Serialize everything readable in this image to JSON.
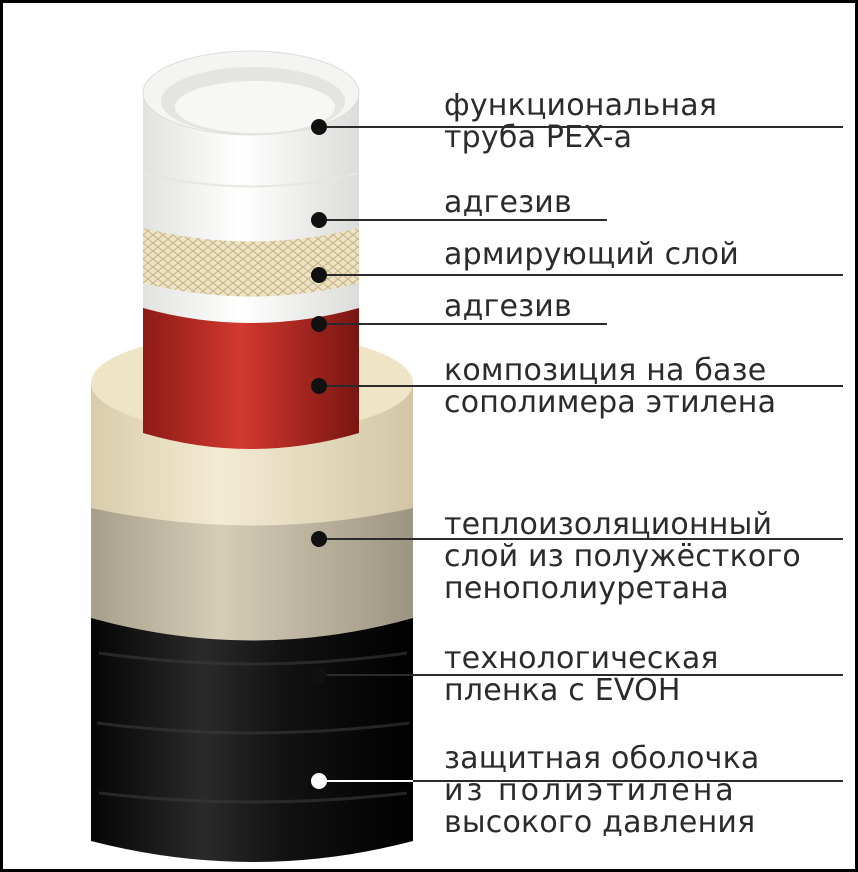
{
  "layers": [
    {
      "id": "pex",
      "lines": [
        "функциональная",
        "труба PEX-a"
      ]
    },
    {
      "id": "adhesive-1",
      "lines": [
        "адгезив"
      ]
    },
    {
      "id": "reinforcing",
      "lines": [
        "армирующий слой"
      ]
    },
    {
      "id": "adhesive-2",
      "lines": [
        "адгезив"
      ]
    },
    {
      "id": "composition",
      "lines": [
        "композиция на базе",
        "сополимера этилена"
      ]
    },
    {
      "id": "insulation",
      "lines": [
        "теплоизоляционный",
        "слой из полужёсткого",
        "пенополиуретана"
      ]
    },
    {
      "id": "film",
      "lines": [
        "технологическая",
        "пленка с EVOH"
      ]
    },
    {
      "id": "jacket",
      "lines": [
        "защитная оболочка",
        "из  полиэтилена",
        "высокого давления"
      ]
    }
  ],
  "colors": {
    "pex": "#f2f2f0",
    "adhesive": "#ffffff",
    "reinforcing": "#e6d9b8",
    "composition": "#c0302a",
    "insulation": "#efe6cb",
    "film": "#cfc6b0",
    "jacket": "#151515",
    "leader_line": "#2b2b2b"
  }
}
